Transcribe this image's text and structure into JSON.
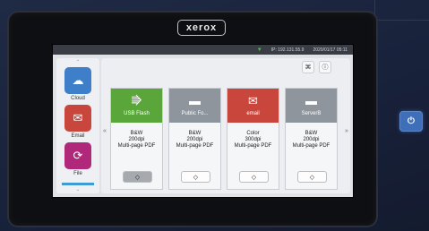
{
  "brand": "xerox",
  "status": {
    "ip": "IP: 192.131.55.9",
    "datetime": "2020/01/17 05:11"
  },
  "sidebar": {
    "items": [
      {
        "label": "Cloud",
        "icon": "cloud-upload-icon",
        "color": "#3f7fc9"
      },
      {
        "label": "Email",
        "icon": "envelope-icon",
        "color": "#c9463d"
      },
      {
        "label": "File",
        "icon": "folder-sync-icon",
        "color": "#b0287a"
      }
    ]
  },
  "cards": [
    {
      "title": "USB Flash",
      "icon": "usb-icon",
      "color": "#5aa63a",
      "lines": [
        "B&W",
        "200dpi",
        "Multi-page PDF"
      ],
      "pressed": true
    },
    {
      "title": "Public Fo...",
      "icon": "network-folder-icon",
      "color": "#8f959c",
      "lines": [
        "B&W",
        "200dpi",
        "Multi-page PDF"
      ],
      "pressed": false
    },
    {
      "title": "email",
      "icon": "envelope-icon",
      "color": "#c9463d",
      "lines": [
        "Color",
        "300dpi",
        "Multi-page PDF"
      ],
      "pressed": false
    },
    {
      "title": "ServerB",
      "icon": "network-folder-icon",
      "color": "#8f959c",
      "lines": [
        "B&W",
        "200dpi",
        "Multi-page PDF"
      ],
      "pressed": false
    }
  ],
  "start_glyph": "◇"
}
